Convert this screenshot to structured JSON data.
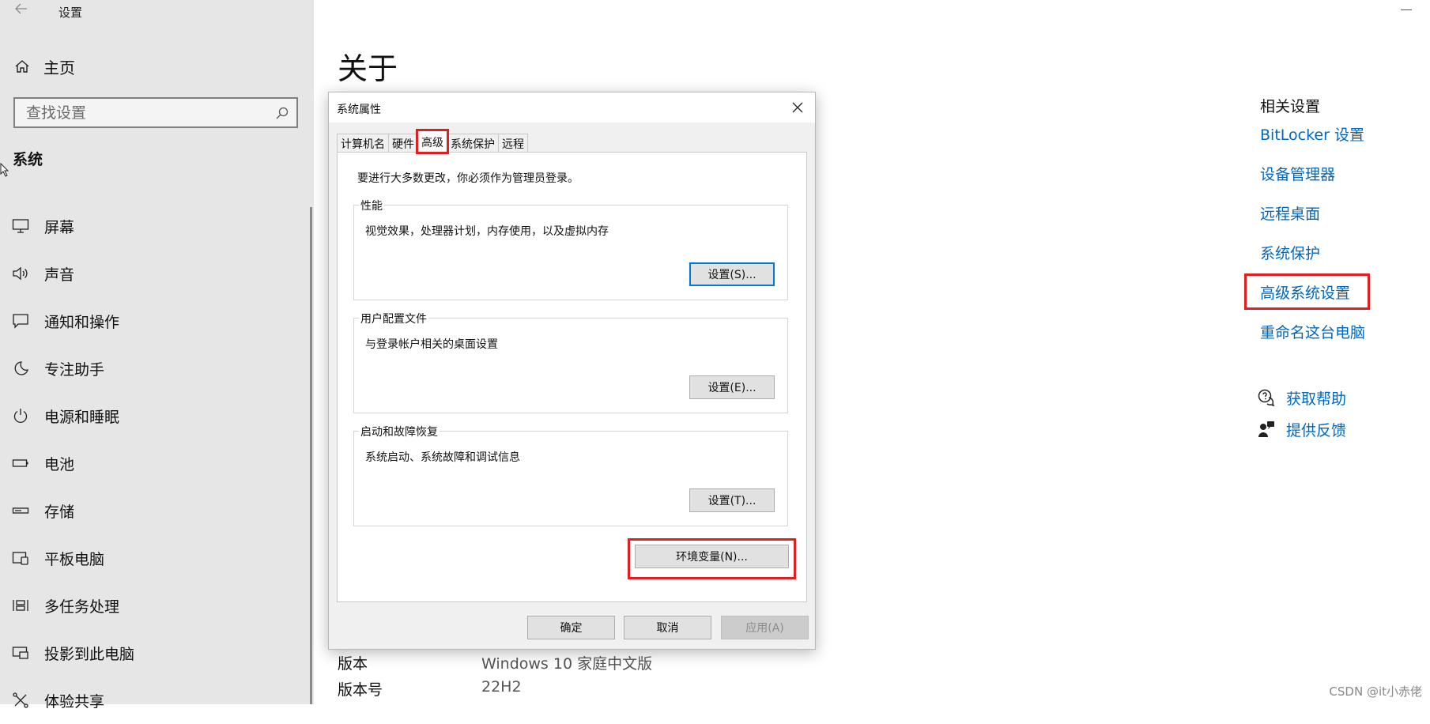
{
  "window": {
    "app_title": "设置"
  },
  "sidebar": {
    "home_label": "主页",
    "search_placeholder": "查找设置",
    "section_heading": "系统",
    "items": [
      {
        "label": "屏幕",
        "icon": "monitor-icon"
      },
      {
        "label": "声音",
        "icon": "speaker-icon"
      },
      {
        "label": "通知和操作",
        "icon": "notification-icon"
      },
      {
        "label": "专注助手",
        "icon": "moon-icon"
      },
      {
        "label": "电源和睡眠",
        "icon": "power-icon"
      },
      {
        "label": "电池",
        "icon": "battery-icon"
      },
      {
        "label": "存储",
        "icon": "storage-icon"
      },
      {
        "label": "平板电脑",
        "icon": "tablet-icon"
      },
      {
        "label": "多任务处理",
        "icon": "multitask-icon"
      },
      {
        "label": "投影到此电脑",
        "icon": "project-icon"
      },
      {
        "label": "体验共享",
        "icon": "share-icon"
      }
    ]
  },
  "main": {
    "title": "关于",
    "specs": [
      {
        "label": "版本",
        "value": "Windows 10 家庭中文版"
      },
      {
        "label": "版本号",
        "value": "22H2"
      }
    ]
  },
  "related": {
    "title": "相关设置",
    "links": [
      {
        "label": "BitLocker 设置"
      },
      {
        "label": "设备管理器"
      },
      {
        "label": "远程桌面"
      },
      {
        "label": "系统保护"
      },
      {
        "label": "高级系统设置",
        "highlighted": true
      },
      {
        "label": "重命名这台电脑"
      }
    ],
    "help_label": "获取帮助",
    "feedback_label": "提供反馈"
  },
  "dialog": {
    "title": "系统属性",
    "tabs": [
      {
        "label": "计算机名",
        "active": false
      },
      {
        "label": "硬件",
        "active": false
      },
      {
        "label": "高级",
        "active": true
      },
      {
        "label": "系统保护",
        "active": false
      },
      {
        "label": "远程",
        "active": false
      }
    ],
    "admin_note": "要进行大多数更改，你必须作为管理员登录。",
    "groups": [
      {
        "label": "性能",
        "desc": "视觉效果，处理器计划，内存使用，以及虚拟内存",
        "button": "设置(S)..."
      },
      {
        "label": "用户配置文件",
        "desc": "与登录帐户相关的桌面设置",
        "button": "设置(E)..."
      },
      {
        "label": "启动和故障恢复",
        "desc": "系统启动、系统故障和调试信息",
        "button": "设置(T)..."
      }
    ],
    "env_button": "环境变量(N)...",
    "ok_button": "确定",
    "cancel_button": "取消",
    "apply_button": "应用(A)"
  },
  "watermark": "CSDN @it小赤佬",
  "colors": {
    "link": "#0067c0",
    "highlight": "#e02020",
    "sidebar_bg": "#e6e6e6",
    "dialog_bg": "#f0f0f0"
  }
}
